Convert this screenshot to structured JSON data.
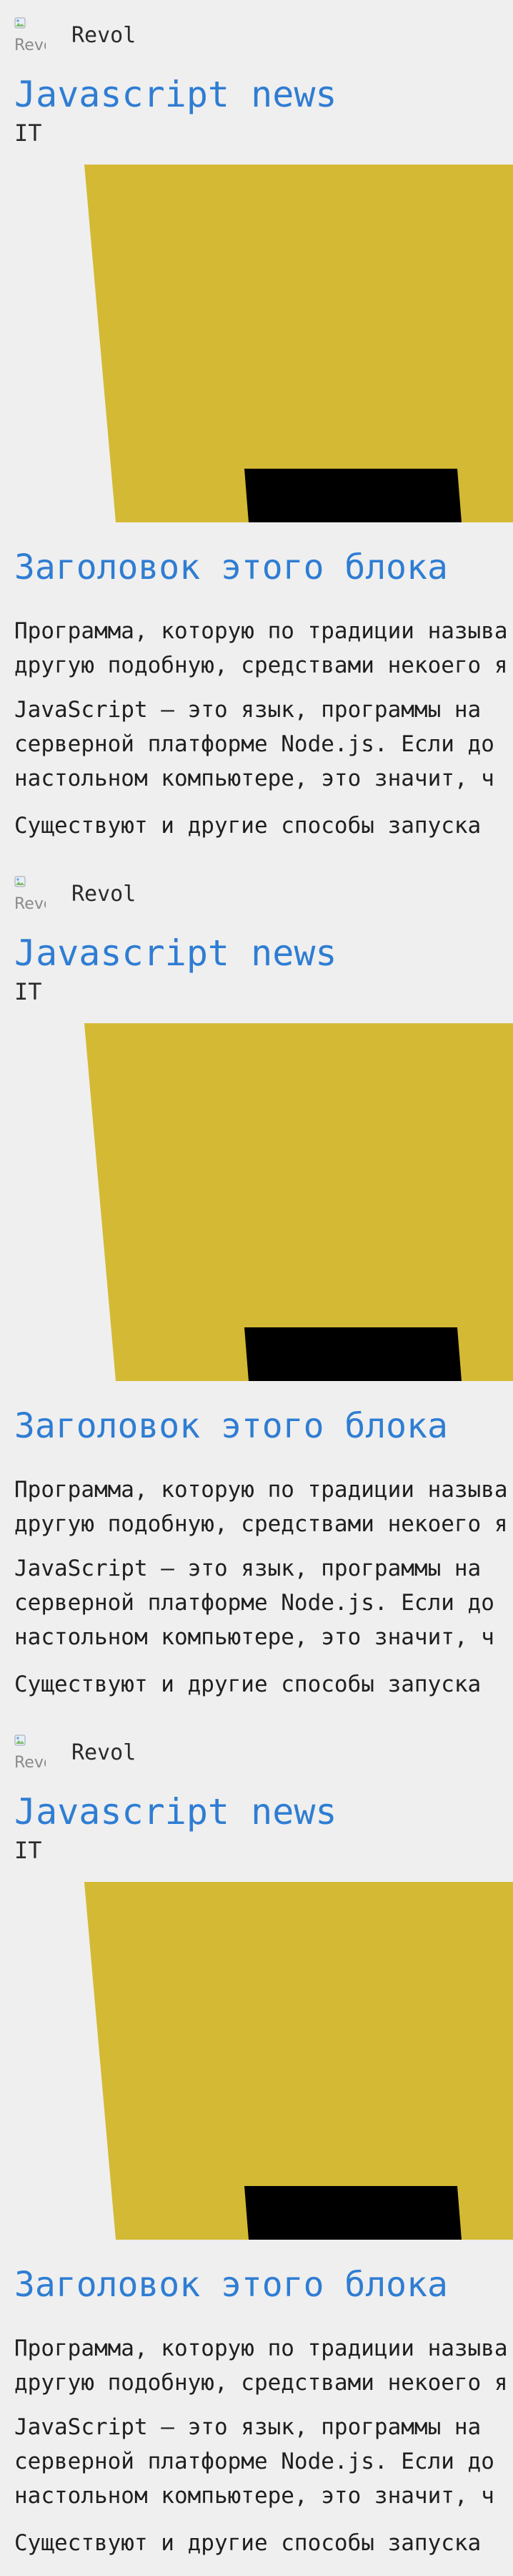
{
  "posts": [
    {
      "author": {
        "name": "Revol",
        "avatar_alt": "Revol"
      },
      "title": "Javascript news",
      "category": "IT",
      "hero": {
        "primary_color": "#d4b934",
        "secondary_color": "#000000",
        "icon": "javascript-logo"
      },
      "block_title": "Заголовок этого блока",
      "paragraphs": [
        [
          "Программа, которую по традиции называ",
          "другую подобную, средствами некоего я"
        ],
        [
          "JavaScript — это язык, программы на",
          "серверной платформе Node.js. Если до",
          "настольном компьютере, это значит, ч"
        ],
        [
          "Существуют и другие способы запуска"
        ]
      ]
    },
    {
      "author": {
        "name": "Revol",
        "avatar_alt": "Revol"
      },
      "title": "Javascript news",
      "category": "IT",
      "hero": {
        "primary_color": "#d4b934",
        "secondary_color": "#000000",
        "icon": "javascript-logo"
      },
      "block_title": "Заголовок этого блока",
      "paragraphs": [
        [
          "Программа, которую по традиции называ",
          "другую подобную, средствами некоего я"
        ],
        [
          "JavaScript — это язык, программы на",
          "серверной платформе Node.js. Если до",
          "настольном компьютере, это значит, ч"
        ],
        [
          "Существуют и другие способы запуска"
        ]
      ]
    },
    {
      "author": {
        "name": "Revol",
        "avatar_alt": "Revol"
      },
      "title": "Javascript news",
      "category": "IT",
      "hero": {
        "primary_color": "#d4b934",
        "secondary_color": "#000000",
        "icon": "javascript-logo"
      },
      "block_title": "Заголовок этого блока",
      "paragraphs": [
        [
          "Программа, которую по традиции называ",
          "другую подобную, средствами некоего я"
        ],
        [
          "JavaScript — это язык, программы на",
          "серверной платформе Node.js. Если до",
          "настольном компьютере, это значит, ч"
        ],
        [
          "Существуют и другие способы запуска"
        ]
      ]
    }
  ],
  "colors": {
    "background": "#efefef",
    "title": "#2f7dd3",
    "text": "#1f1f1f"
  }
}
